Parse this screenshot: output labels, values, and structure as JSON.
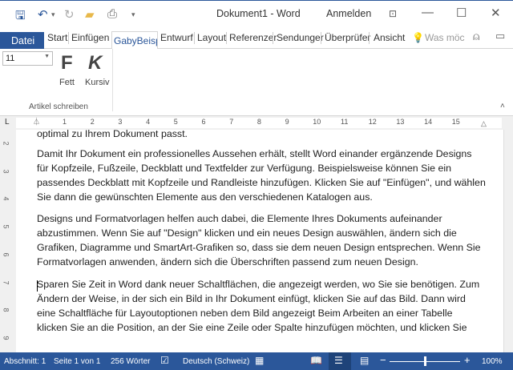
{
  "window": {
    "title": "Dokument1  -  Word",
    "signin": "Anmelden"
  },
  "quick_access": {
    "icons": [
      "save-icon",
      "undo-icon",
      "redo-icon",
      "open-folder-icon",
      "print-preview-icon",
      "customize-icon"
    ]
  },
  "tabs": {
    "file": "Datei",
    "items": [
      "Start",
      "Einfügen",
      "GabyBeispi",
      "Entwurf",
      "Layout",
      "Referenzer",
      "Sendunger",
      "Überprüfer",
      "Ansicht"
    ],
    "active": "GabyBeispi",
    "tellme": "Was möc"
  },
  "ribbon": {
    "font_size": "11",
    "bold_glyph": "F",
    "bold_label": "Fett",
    "italic_glyph": "K",
    "italic_label": "Kursiv",
    "group_label": "Artikel schreiben"
  },
  "ruler": {
    "h": [
      "1",
      "2",
      "3",
      "4",
      "5",
      "6",
      "7",
      "8",
      "9",
      "10",
      "11",
      "12",
      "13",
      "14",
      "15"
    ],
    "v": [
      "2",
      "3",
      "4",
      "5",
      "6",
      "7",
      "8",
      "9"
    ]
  },
  "document": {
    "lines": [
      "optimal zu Ihrem Dokument passt.",
      "Damit Ihr Dokument ein professionelles Aussehen erhält, stellt Word einander ergänzende Designs",
      "für Kopfzeile, Fußzeile, Deckblatt und Textfelder zur Verfügung. Beispielsweise können Sie ein",
      "passendes Deckblatt mit Kopfzeile und Randleiste hinzufügen. Klicken Sie auf \"Einfügen\", und wählen",
      "Sie dann die gewünschten Elemente aus den verschiedenen Katalogen aus.",
      "Designs und Formatvorlagen helfen auch dabei, die Elemente Ihres Dokuments aufeinander",
      "abzustimmen. Wenn Sie auf \"Design\" klicken und ein neues Design auswählen, ändern sich die",
      "Grafiken, Diagramme und SmartArt-Grafiken so, dass sie dem neuen Design entsprechen. Wenn Sie",
      "Formatvorlagen anwenden, ändern sich die Überschriften passend zum neuen Design.",
      "Sparen Sie Zeit in Word dank neuer Schaltflächen, die angezeigt werden, wo Sie sie benötigen. Zum",
      "Ändern der Weise, in der sich ein Bild in Ihr Dokument einfügt, klicken Sie auf das Bild. Dann wird",
      "eine Schaltfläche für Layoutoptionen neben dem Bild angezeigt Beim Arbeiten an einer Tabelle",
      "klicken Sie an die Position, an der Sie eine Zeile oder Spalte hinzufügen möchten, und klicken Sie"
    ]
  },
  "status": {
    "section": "Abschnitt: 1",
    "page": "Seite 1 von 1",
    "words": "256 Wörter",
    "language": "Deutsch (Schweiz)",
    "zoom_percent": "100%",
    "zoom_value": 100
  },
  "colors": {
    "accent": "#2b579a"
  }
}
